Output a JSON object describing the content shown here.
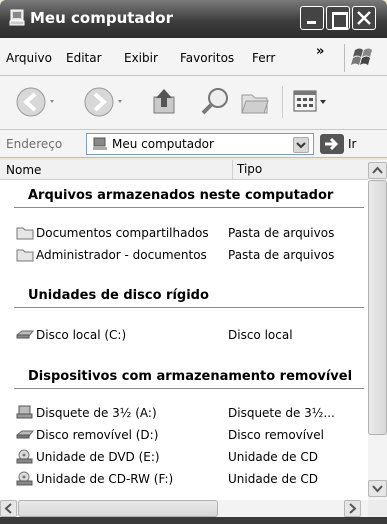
{
  "window": {
    "title": "Meu computador"
  },
  "menu": {
    "items": [
      {
        "label": "Arquivo"
      },
      {
        "label": "Editar"
      },
      {
        "label": "Exibir"
      },
      {
        "label": "Favoritos"
      },
      {
        "label": "Ferr"
      }
    ],
    "more": "»"
  },
  "address": {
    "label": "Endereço",
    "value": "Meu computador",
    "go_label": "Ir"
  },
  "columns": {
    "name": "Nome",
    "type": "Tipo"
  },
  "groups": [
    {
      "title": "Arquivos armazenados neste computador",
      "items": [
        {
          "name": "Documentos compartilhados",
          "type": "Pasta de arquivos",
          "icon": "folder-icon"
        },
        {
          "name": "Administrador - documentos",
          "type": "Pasta de arquivos",
          "icon": "folder-icon"
        }
      ]
    },
    {
      "title": "Unidades de disco rígido",
      "items": [
        {
          "name": "Disco local (C:)",
          "type": "Disco local",
          "icon": "hard-disk-icon"
        }
      ]
    },
    {
      "title": "Dispositivos com armazenamento removível",
      "items": [
        {
          "name": "Disquete de 3½ (A:)",
          "type": "Disquete de 3½...",
          "icon": "floppy-drive-icon"
        },
        {
          "name": "Disco removível (D:)",
          "type": "Disco removível",
          "icon": "removable-disk-icon"
        },
        {
          "name": "Unidade de DVD (E:)",
          "type": "Unidade de CD",
          "icon": "dvd-drive-icon"
        },
        {
          "name": "Unidade de CD-RW (F:)",
          "type": "Unidade de CD",
          "icon": "cd-drive-icon"
        }
      ]
    }
  ]
}
